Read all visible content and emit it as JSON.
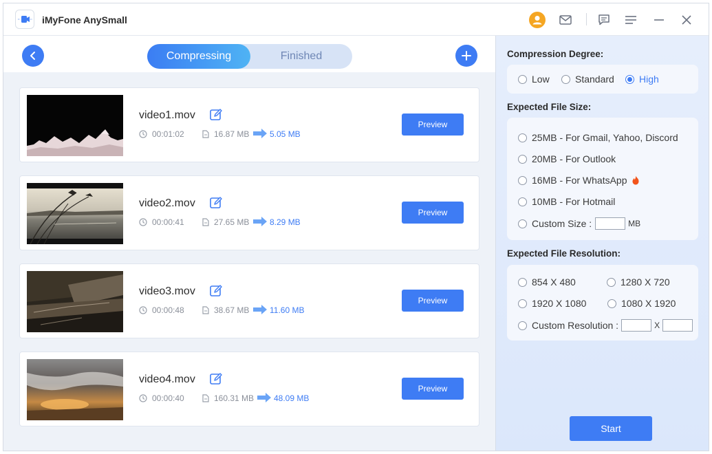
{
  "app": {
    "title": "iMyFone AnySmall"
  },
  "tabs": {
    "compressing": "Compressing",
    "finished": "Finished"
  },
  "videos": [
    {
      "name": "video1.mov",
      "duration": "00:01:02",
      "original_size": "16.87 MB",
      "compressed_size": "5.05 MB",
      "preview_label": "Preview"
    },
    {
      "name": "video2.mov",
      "duration": "00:00:41",
      "original_size": "27.65 MB",
      "compressed_size": "8.29 MB",
      "preview_label": "Preview"
    },
    {
      "name": "video3.mov",
      "duration": "00:00:48",
      "original_size": "38.67 MB",
      "compressed_size": "11.60 MB",
      "preview_label": "Preview"
    },
    {
      "name": "video4.mov",
      "duration": "00:00:40",
      "original_size": "160.31 MB",
      "compressed_size": "48.09 MB",
      "preview_label": "Preview"
    }
  ],
  "compression": {
    "title": "Compression Degree:",
    "options": [
      "Low",
      "Standard",
      "High"
    ],
    "selected": "High"
  },
  "file_size": {
    "title": "Expected File Size:",
    "options": [
      "25MB - For Gmail, Yahoo, Discord",
      "20MB - For Outlook",
      "16MB - For WhatsApp",
      "10MB - For Hotmail"
    ],
    "custom_label": "Custom Size :",
    "custom_value": "",
    "custom_unit": "MB"
  },
  "resolution": {
    "title": "Expected File Resolution:",
    "options": [
      "854 X 480",
      "1280 X 720",
      "1920 X 1080",
      "1080 X 1920"
    ],
    "custom_label": "Custom Resolution :",
    "custom_separator": "X",
    "custom_width": "",
    "custom_height": ""
  },
  "start_label": "Start",
  "colors": {
    "accent": "#3e7cf4",
    "hot": "#f2541b",
    "user_icon": "#f5a623"
  },
  "icons": [
    "user-icon",
    "mail-icon",
    "feedback-icon",
    "menu-icon",
    "minimize-icon",
    "close-icon",
    "back-icon",
    "add-icon",
    "edit-icon",
    "clock-icon",
    "file-icon",
    "arrow-right-icon",
    "fire-icon"
  ]
}
